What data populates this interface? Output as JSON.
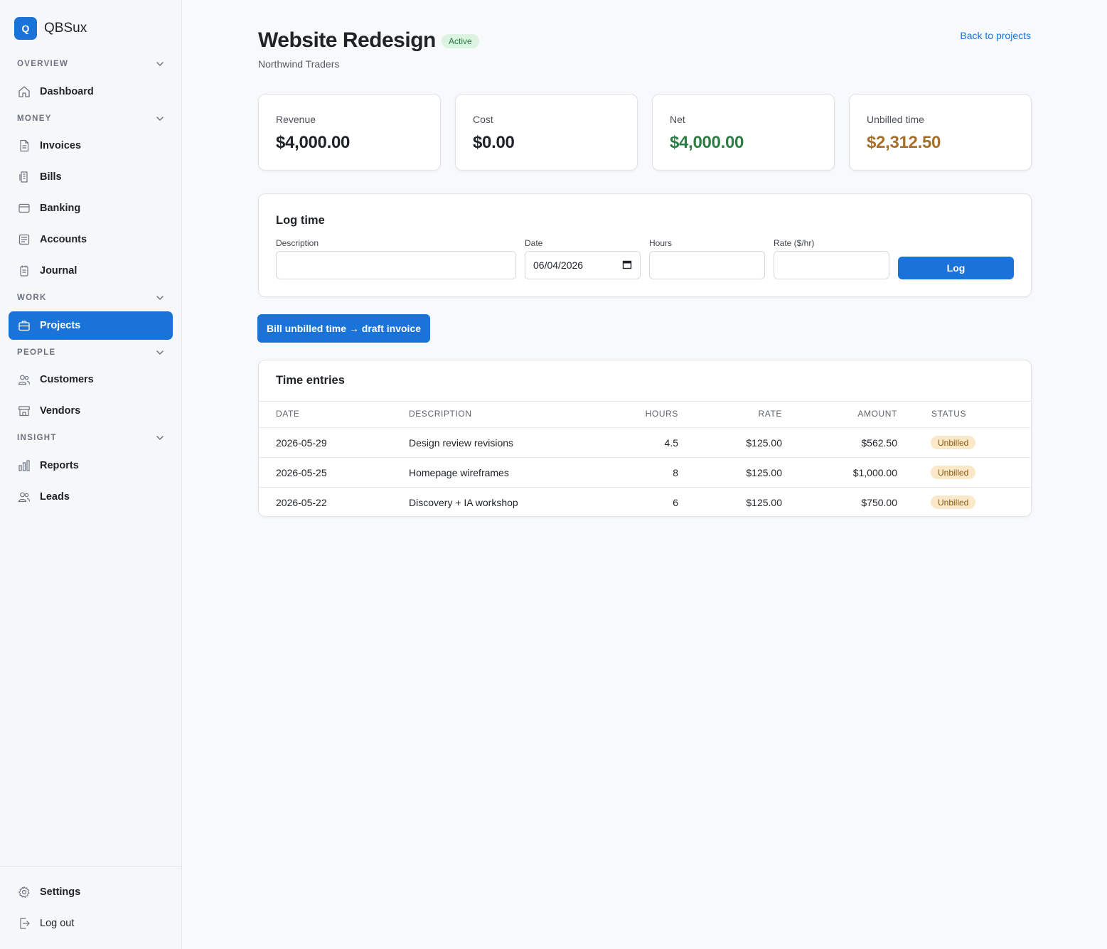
{
  "brand": {
    "logo_letter": "Q",
    "name": "QBSux"
  },
  "sidebar": {
    "sections": [
      {
        "label": "OVERVIEW"
      },
      {
        "label": "MONEY"
      },
      {
        "label": "WORK"
      },
      {
        "label": "PEOPLE"
      },
      {
        "label": "INSIGHT"
      }
    ],
    "items": [
      {
        "label": "Dashboard",
        "icon": "home-icon"
      },
      {
        "label": "Invoices",
        "icon": "document-icon"
      },
      {
        "label": "Bills",
        "icon": "receipt-icon"
      },
      {
        "label": "Banking",
        "icon": "bank-card-icon"
      },
      {
        "label": "Accounts",
        "icon": "ledger-icon"
      },
      {
        "label": "Journal",
        "icon": "journal-icon"
      },
      {
        "label": "Projects",
        "icon": "briefcase-icon",
        "active": true
      },
      {
        "label": "Customers",
        "icon": "users-icon"
      },
      {
        "label": "Vendors",
        "icon": "store-icon"
      },
      {
        "label": "Reports",
        "icon": "bar-chart-icon"
      },
      {
        "label": "Leads",
        "icon": "users-icon"
      }
    ],
    "footer": [
      {
        "label": "Settings",
        "icon": "gear-icon"
      },
      {
        "label": "Log out",
        "icon": "logout-icon"
      }
    ]
  },
  "header": {
    "title": "Website Redesign",
    "status": "Active",
    "customer": "Northwind Traders",
    "back_link": "Back to projects"
  },
  "stats": [
    {
      "label": "Revenue",
      "value": "$4,000.00",
      "color": "#1f2328"
    },
    {
      "label": "Cost",
      "value": "$0.00",
      "color": "#1f2328"
    },
    {
      "label": "Net",
      "value": "$4,000.00",
      "color": "#2e7d45"
    },
    {
      "label": "Unbilled time",
      "value": "$2,312.50",
      "color": "#a86f2c"
    }
  ],
  "log_time": {
    "title": "Log time",
    "description_label": "Description",
    "description_value": "",
    "date_label": "Date",
    "date_value": "06/04/2026",
    "hours_label": "Hours",
    "hours_value": "",
    "rate_label": "Rate ($/hr)",
    "rate_value": "",
    "button": "Log"
  },
  "bill_button": "Bill unbilled time → draft invoice",
  "entries": {
    "title": "Time entries",
    "columns": [
      "DATE",
      "DESCRIPTION",
      "HOURS",
      "RATE",
      "AMOUNT",
      "STATUS"
    ],
    "rows": [
      {
        "date": "2026-05-29",
        "description": "Design review revisions",
        "hours": "4.5",
        "rate": "$125.00",
        "amount": "$562.50",
        "status": "Unbilled"
      },
      {
        "date": "2026-05-25",
        "description": "Homepage wireframes",
        "hours": "8",
        "rate": "$125.00",
        "amount": "$1,000.00",
        "status": "Unbilled"
      },
      {
        "date": "2026-05-22",
        "description": "Discovery + IA workshop",
        "hours": "6",
        "rate": "$125.00",
        "amount": "$750.00",
        "status": "Unbilled"
      }
    ]
  },
  "colors": {
    "accent": "#1a73d8",
    "active_pill_bg": "#dcf3e2",
    "unbilled_badge_bg": "#fbe8c9"
  }
}
